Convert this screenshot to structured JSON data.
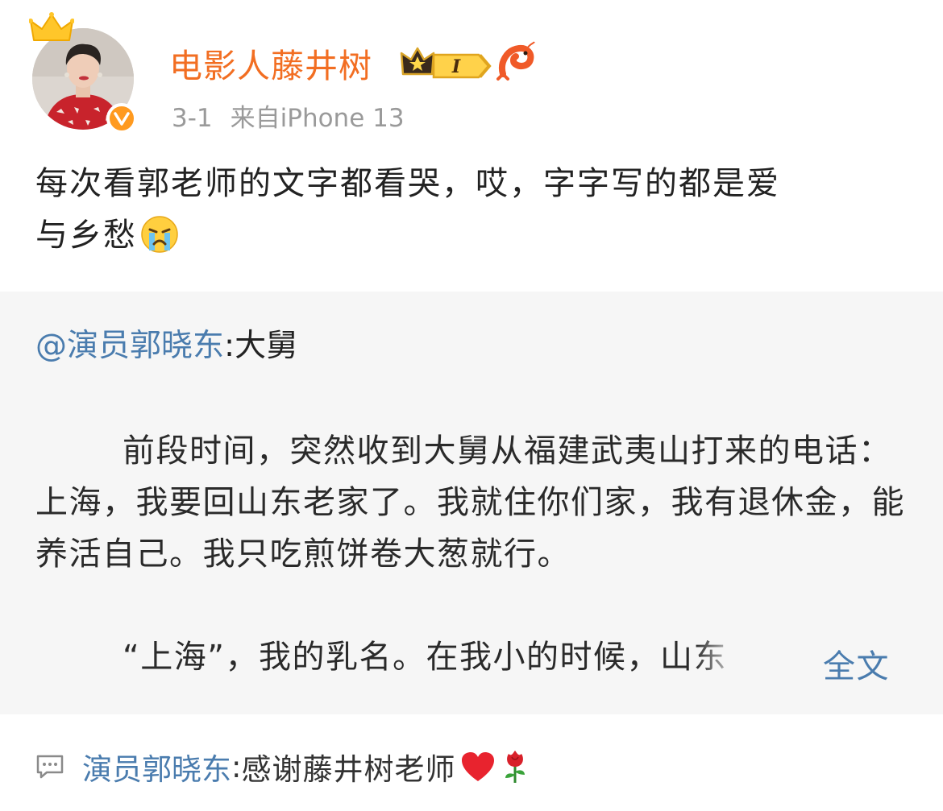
{
  "post": {
    "author": "电影人藤井树",
    "date": "3-1",
    "source": "来自iPhone 13",
    "vip_level": "I",
    "text_line1": "每次看郭老师的文字都看哭，哎，字字写的都是爱",
    "text_line2": "与乡愁",
    "emoji": "crying-face-icon"
  },
  "repost": {
    "author": "@演员郭晓东",
    "separator": ":",
    "title": "大舅",
    "para1": "前段时间，突然收到大舅从福建武夷山打来的电话：上海，我要回山东老家了。我就住你们家，我有退休金，能养活自己。我只吃煎饼卷大葱就行。",
    "para2": "“上海”，我的乳名。在我小的时候，山东",
    "more_link": "全文"
  },
  "comment": {
    "author": "演员郭晓东",
    "separator": ":",
    "text": " 感谢藤井树老师"
  },
  "colors": {
    "username": "#f26e22",
    "link": "#4a7cae",
    "meta": "#9a9a9a",
    "repost_bg": "#f6f6f6",
    "verified": "#ff9a1f"
  }
}
